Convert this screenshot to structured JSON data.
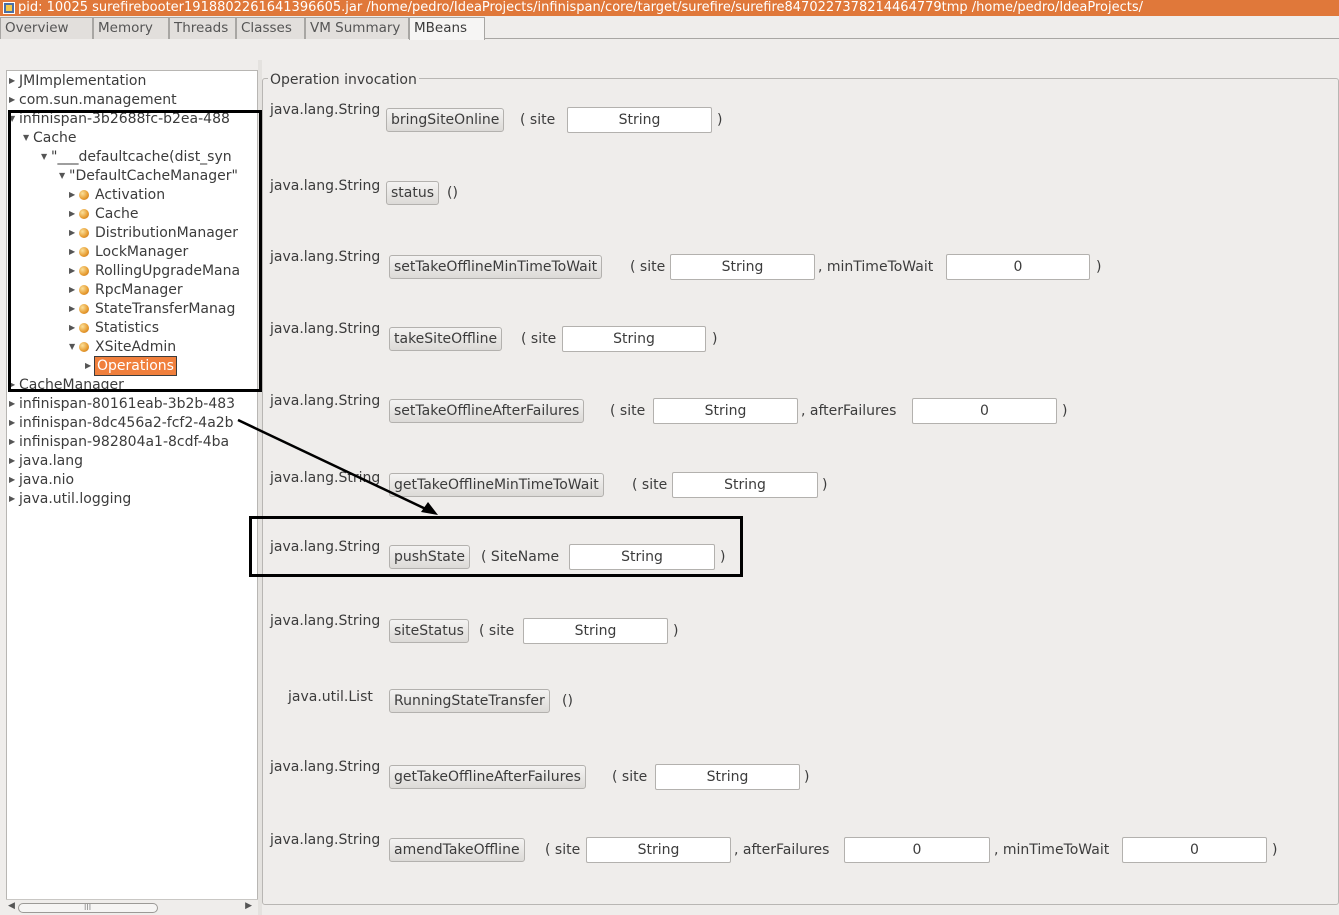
{
  "window": {
    "title": "pid: 10025 surefirebooter1918802261641396605.jar /home/pedro/IdeaProjects/infinispan/core/target/surefire/surefire8470227378214464779tmp /home/pedro/IdeaProjects/"
  },
  "tabs": [
    "Overview",
    "Memory",
    "Threads",
    "Classes",
    "VM Summary",
    "MBeans"
  ],
  "tree": {
    "items": [
      "JMImplementation",
      "com.sun.management",
      "infinispan-3b2688fc-b2ea-488",
      "Cache",
      "\"___defaultcache(dist_syn",
      "\"DefaultCacheManager\"",
      "Activation",
      "Cache",
      "DistributionManager",
      "LockManager",
      "RollingUpgradeMana",
      "RpcManager",
      "StateTransferManag",
      "Statistics",
      "XSiteAdmin",
      "Operations",
      "CacheManager",
      "infinispan-80161eab-3b2b-483",
      "infinispan-8dc456a2-fcf2-4a2b",
      "infinispan-982804a1-8cdf-4ba",
      "java.lang",
      "java.nio",
      "java.util.logging"
    ],
    "scroll_grip": "III"
  },
  "panel": {
    "legend": "Operation invocation",
    "operations": [
      {
        "return": "java.lang.String",
        "name": "bringSiteOnline",
        "open": "( site",
        "inputs": [
          "String"
        ],
        "between": [],
        "close": ")"
      },
      {
        "return": "java.lang.String",
        "name": "status",
        "open": "()",
        "inputs": [],
        "between": [],
        "close": ""
      },
      {
        "return": "java.lang.String",
        "name": "setTakeOfflineMinTimeToWait",
        "open": "( site",
        "inputs": [
          "String",
          "0"
        ],
        "between": [
          ", minTimeToWait"
        ],
        "close": ")"
      },
      {
        "return": "java.lang.String",
        "name": "takeSiteOffline",
        "open": "( site",
        "inputs": [
          "String"
        ],
        "between": [],
        "close": ")"
      },
      {
        "return": "java.lang.String",
        "name": "setTakeOfflineAfterFailures",
        "open": "( site",
        "inputs": [
          "String",
          "0"
        ],
        "between": [
          ", afterFailures"
        ],
        "close": ")"
      },
      {
        "return": "java.lang.String",
        "name": "getTakeOfflineMinTimeToWait",
        "open": "( site",
        "inputs": [
          "String"
        ],
        "between": [],
        "close": ")"
      },
      {
        "return": "java.lang.String",
        "name": "pushState",
        "open": "( SiteName",
        "inputs": [
          "String"
        ],
        "between": [],
        "close": ")"
      },
      {
        "return": "java.lang.String",
        "name": "siteStatus",
        "open": "( site",
        "inputs": [
          "String"
        ],
        "between": [],
        "close": ")"
      },
      {
        "return": "java.util.List",
        "name": "RunningStateTransfer",
        "open": "()",
        "inputs": [],
        "between": [],
        "close": ""
      },
      {
        "return": "java.lang.String",
        "name": "getTakeOfflineAfterFailures",
        "open": "( site",
        "inputs": [
          "String"
        ],
        "between": [],
        "close": ")"
      },
      {
        "return": "java.lang.String",
        "name": "amendTakeOffline",
        "open": "( site",
        "inputs": [
          "String",
          "0",
          "0"
        ],
        "between": [
          ", afterFailures",
          ", minTimeToWait"
        ],
        "close": ")"
      }
    ]
  },
  "colors": {
    "accent": "#e0783a",
    "selection": "#f07f3c",
    "annotation": "#000000"
  }
}
